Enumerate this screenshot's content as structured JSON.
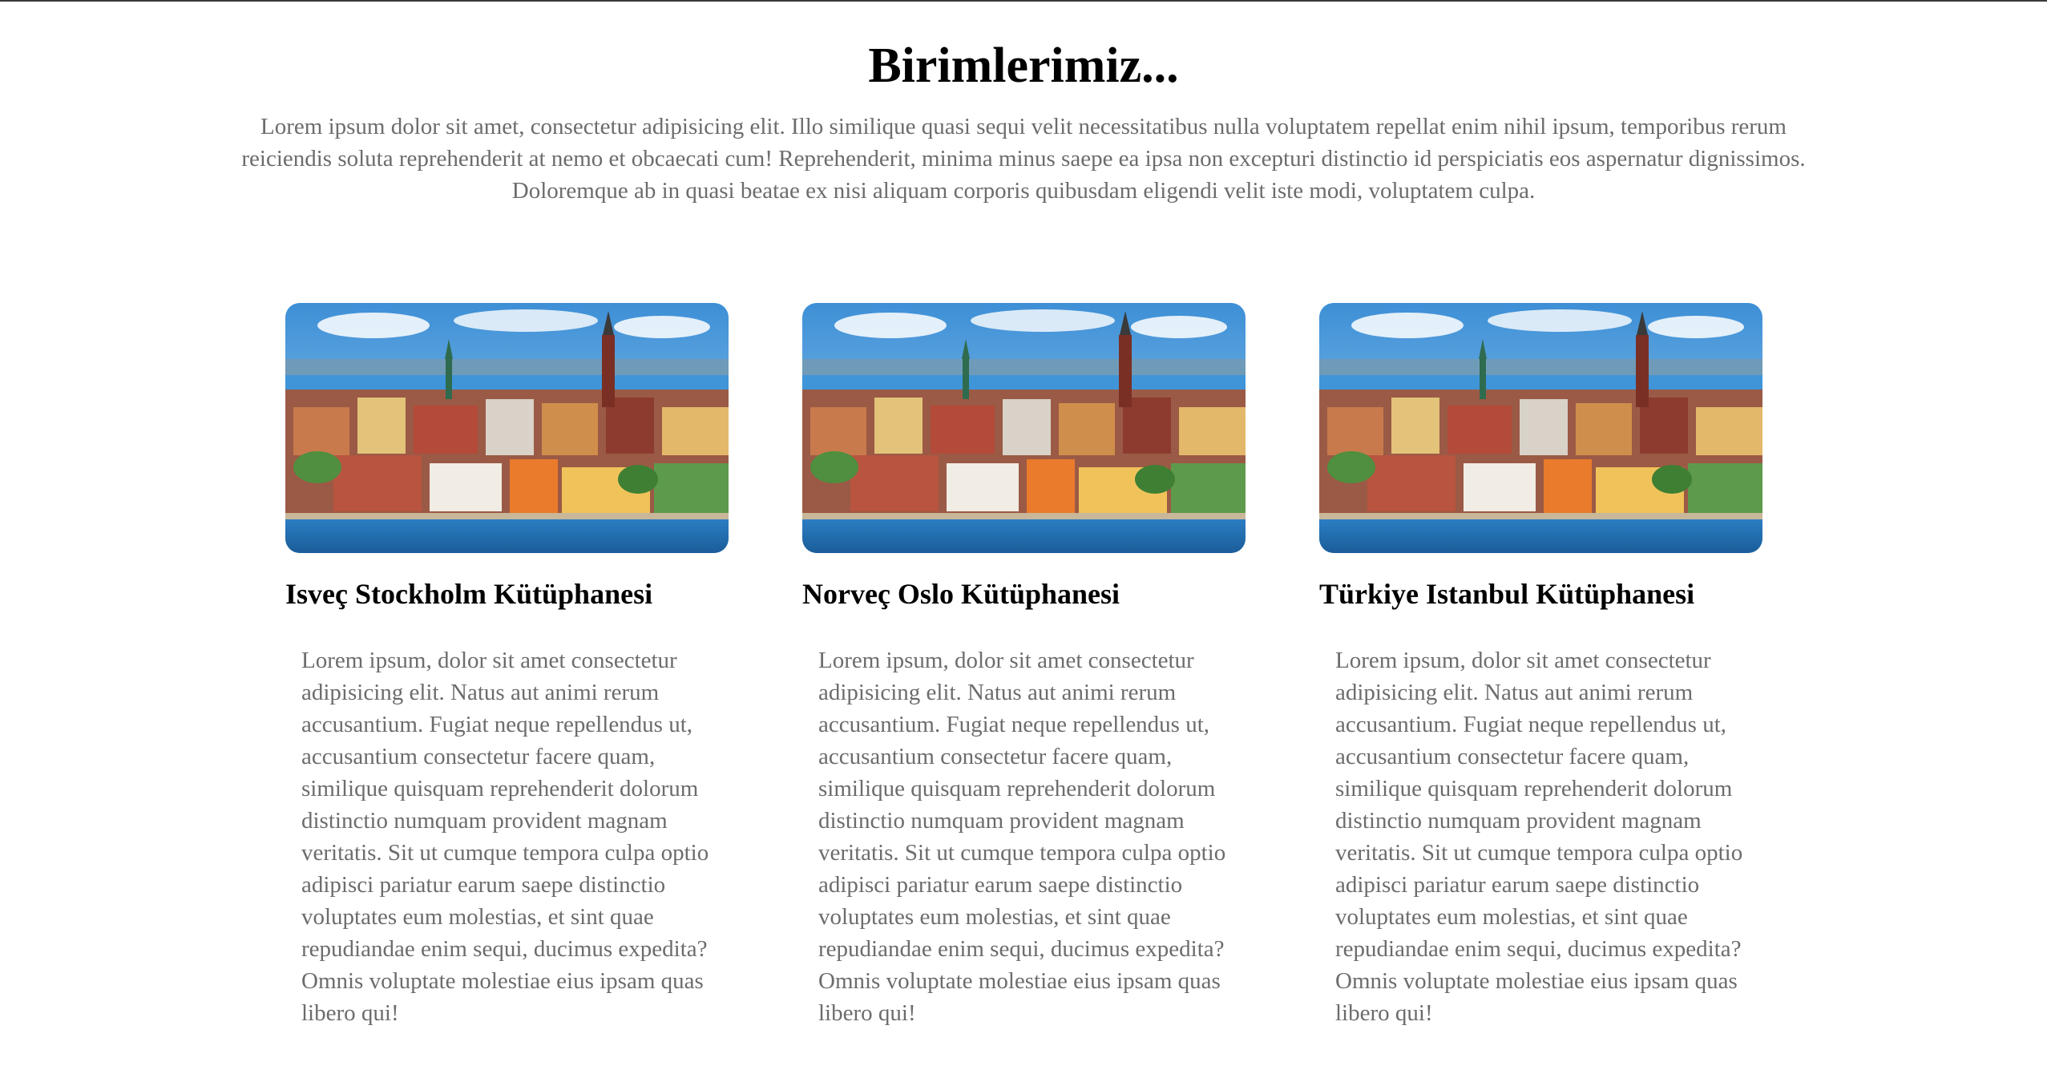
{
  "section": {
    "title": "Birimlerimiz...",
    "intro": "Lorem ipsum dolor sit amet, consectetur adipisicing elit. Illo similique quasi sequi velit necessitatibus nulla voluptatem repellat enim nihil ipsum, temporibus rerum reiciendis soluta reprehenderit at nemo et obcaecati cum! Reprehenderit, minima minus saepe ea ipsa non excepturi distinctio id perspiciatis eos aspernatur dignissimos. Doloremque ab in quasi beatae ex nisi aliquam corporis quibusdam eligendi velit iste modi, voluptatem culpa."
  },
  "cards": [
    {
      "title": "Isveç Stockholm Kütüphanesi",
      "text": "Lorem ipsum, dolor sit amet consectetur adipisicing elit. Natus aut animi rerum accusantium. Fugiat neque repellendus ut, accusantium consectetur facere quam, similique quisquam reprehenderit dolorum distinctio numquam provident magnam veritatis. Sit ut cumque tempora culpa optio adipisci pariatur earum saepe distinctio voluptates eum molestias, et sint quae repudiandae enim sequi, ducimus expedita? Omnis voluptate molestiae eius ipsam quas libero qui!"
    },
    {
      "title": "Norveç Oslo Kütüphanesi",
      "text": "Lorem ipsum, dolor sit amet consectetur adipisicing elit. Natus aut animi rerum accusantium. Fugiat neque repellendus ut, accusantium consectetur facere quam, similique quisquam reprehenderit dolorum distinctio numquam provident magnam veritatis. Sit ut cumque tempora culpa optio adipisci pariatur earum saepe distinctio voluptates eum molestias, et sint quae repudiandae enim sequi, ducimus expedita? Omnis voluptate molestiae eius ipsam quas libero qui!"
    },
    {
      "title": "Türkiye Istanbul Kütüphanesi",
      "text": "Lorem ipsum, dolor sit amet consectetur adipisicing elit. Natus aut animi rerum accusantium. Fugiat neque repellendus ut, accusantium consectetur facere quam, similique quisquam reprehenderit dolorum distinctio numquam provident magnam veritatis. Sit ut cumque tempora culpa optio adipisci pariatur earum saepe distinctio voluptates eum molestias, et sint quae repudiandae enim sequi, ducimus expedita? Omnis voluptate molestiae eius ipsam quas libero qui!"
    }
  ],
  "colors": {
    "heading": "#000000",
    "body_text": "#6c6c6c",
    "top_rule": "#3a3a3a"
  }
}
